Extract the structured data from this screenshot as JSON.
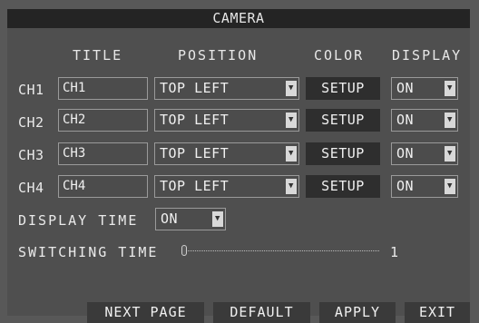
{
  "window": {
    "title": "CAMERA"
  },
  "headers": {
    "title": "TITLE",
    "position": "POSITION",
    "color": "COLOR",
    "display": "DISPLAY"
  },
  "channels": [
    {
      "label": "CH1",
      "title_value": "CH1",
      "position": "TOP LEFT",
      "color_button": "SETUP",
      "display": "ON"
    },
    {
      "label": "CH2",
      "title_value": "CH2",
      "position": "TOP LEFT",
      "color_button": "SETUP",
      "display": "ON"
    },
    {
      "label": "CH3",
      "title_value": "CH3",
      "position": "TOP LEFT",
      "color_button": "SETUP",
      "display": "ON"
    },
    {
      "label": "CH4",
      "title_value": "CH4",
      "position": "TOP LEFT",
      "color_button": "SETUP",
      "display": "ON"
    }
  ],
  "display_time": {
    "label": "DISPLAY TIME",
    "value": "ON"
  },
  "switching_time": {
    "label": "SWITCHING TIME",
    "value": "1"
  },
  "buttons": {
    "next_page": "NEXT PAGE",
    "default": "DEFAULT",
    "apply": "APPLY",
    "exit": "EXIT"
  },
  "icons": {
    "dropdown": "dropdown-arrow-icon"
  },
  "colors": {
    "background": "#585858",
    "title_bar": "#242424",
    "button": "#2e2e2e",
    "text": "#eaeaea"
  }
}
